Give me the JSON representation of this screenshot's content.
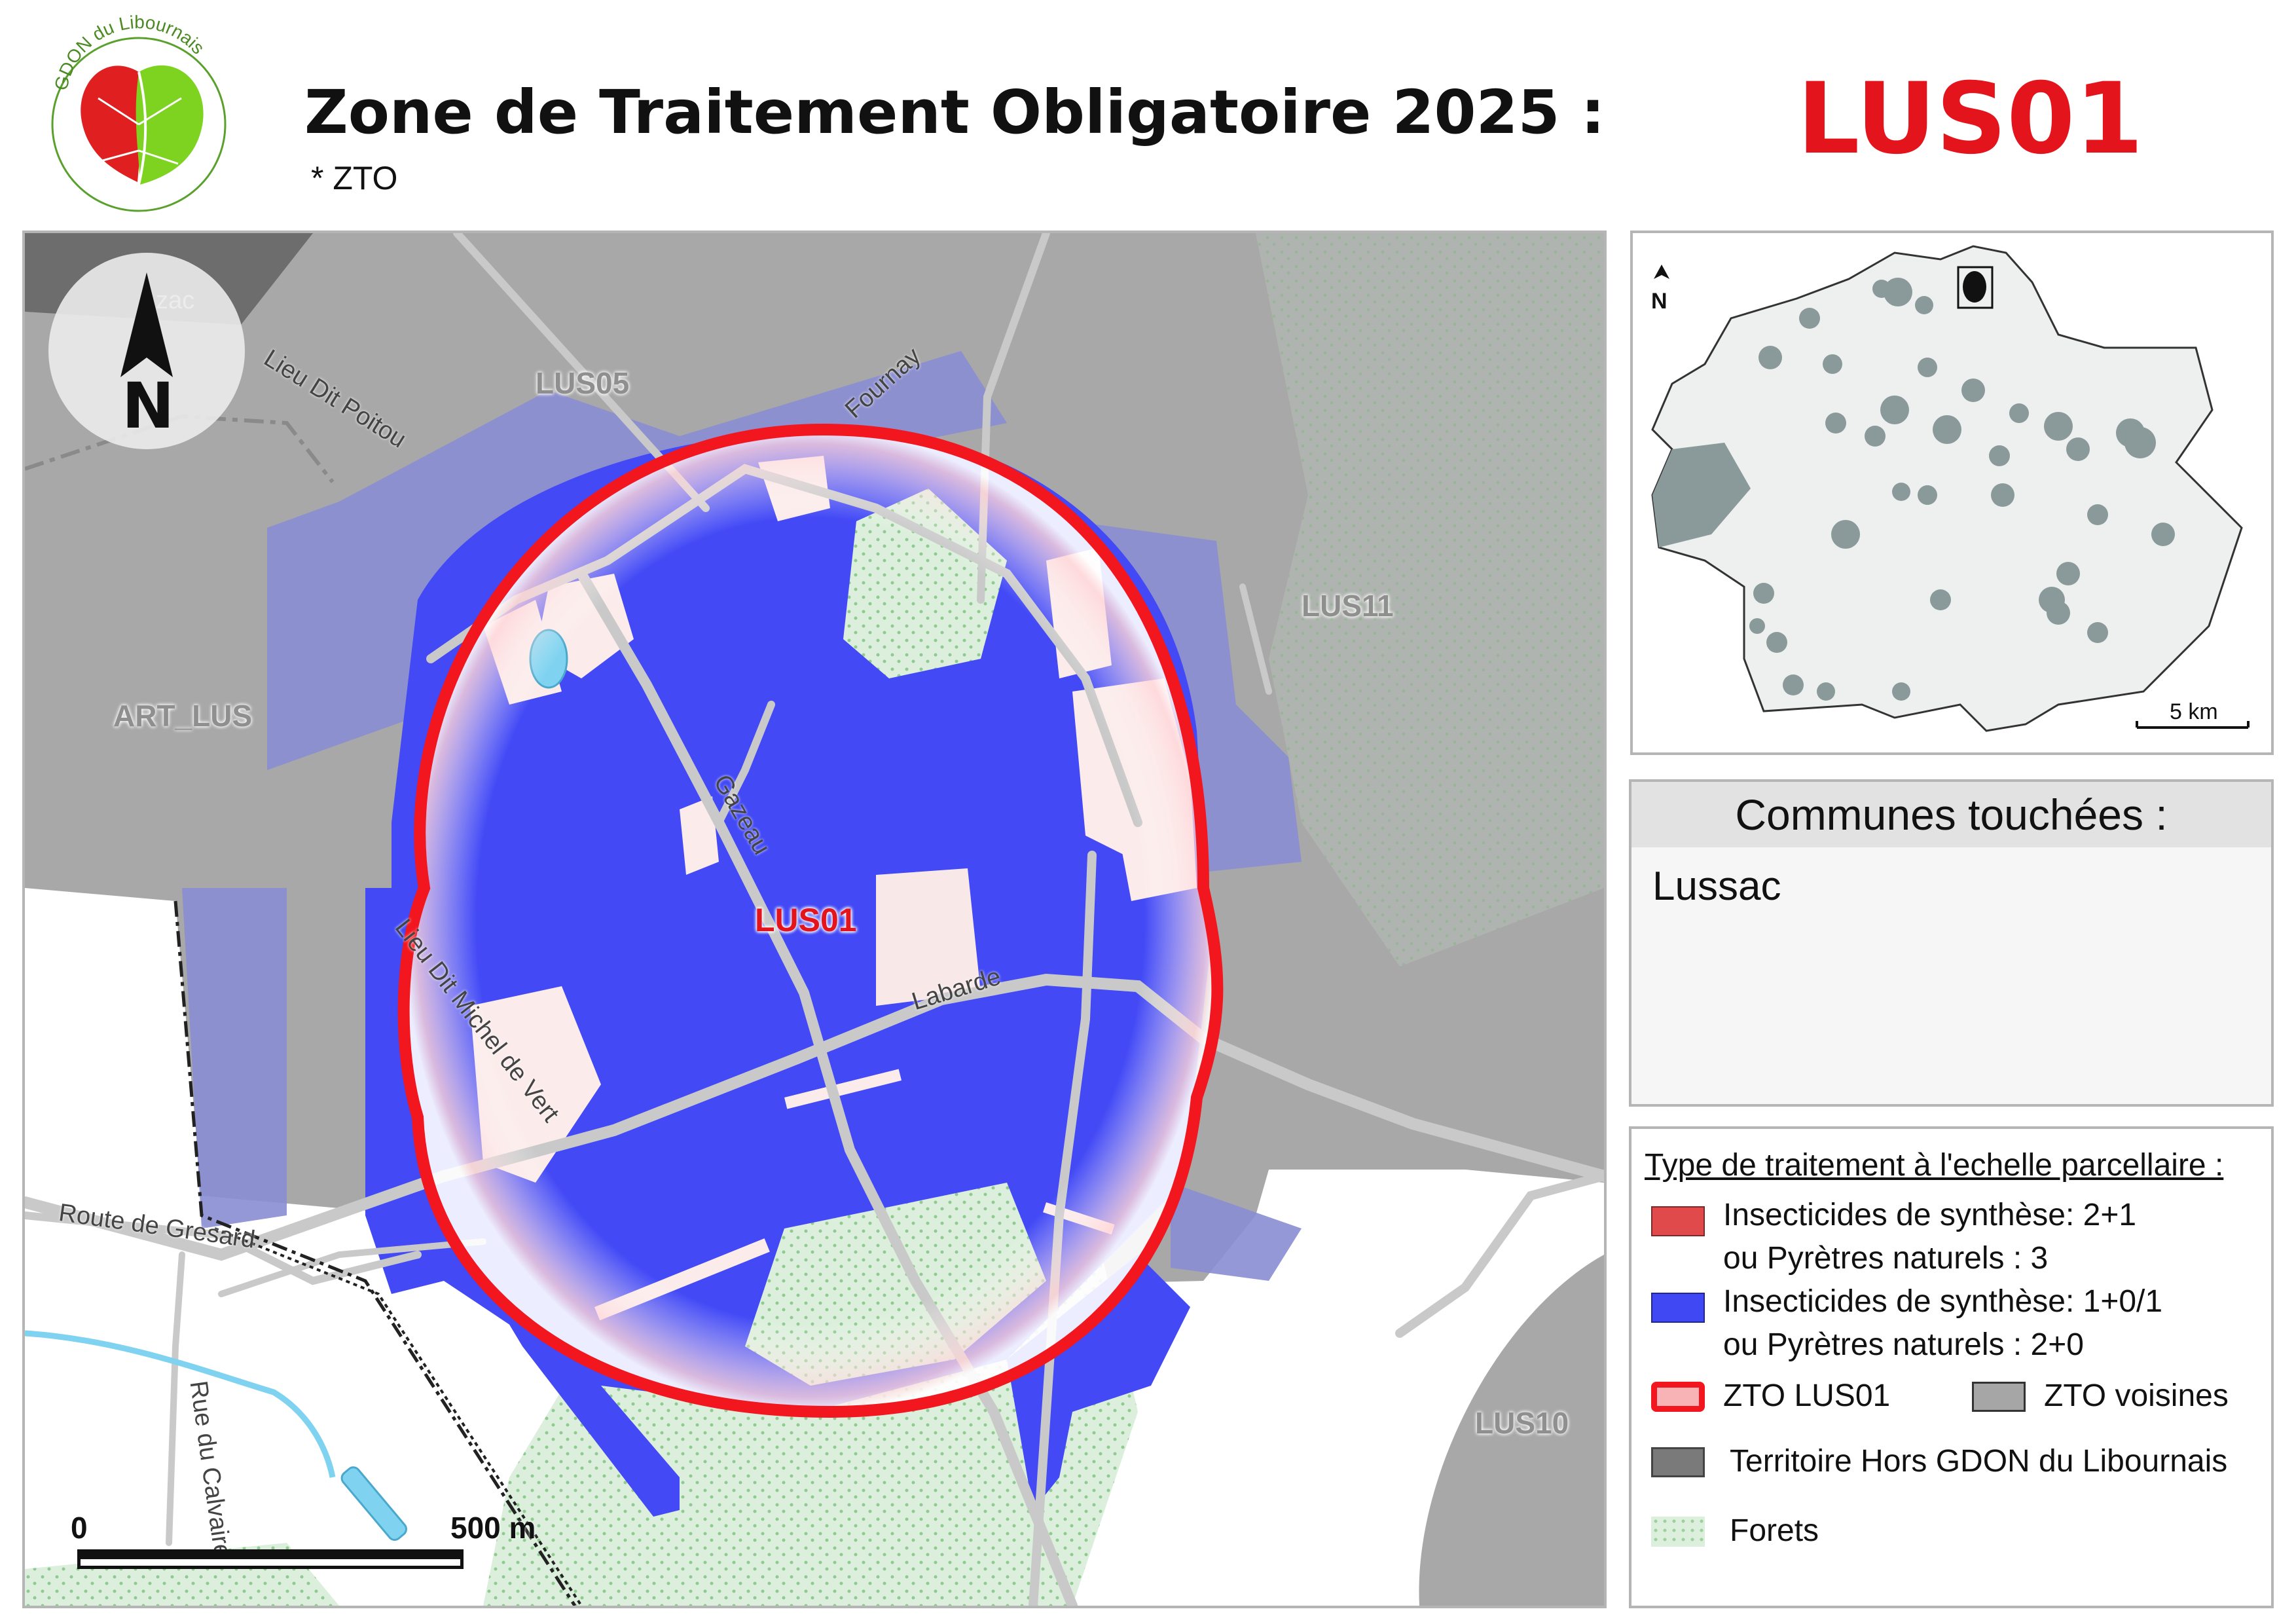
{
  "header": {
    "title": "Zone de Traitement Obligatoire 2025 :",
    "subtitle": "* ZTO",
    "zone_code": "LUS01"
  },
  "logo": {
    "text": "GDON du Libournais",
    "colors": [
      "#e02020",
      "#7ed321",
      "#5aa02c"
    ]
  },
  "main_map": {
    "zone_labels": {
      "center": "LUS01",
      "north": "LUS05",
      "east": "LUS11",
      "west": "ART_LUS",
      "southeast": "LUS10"
    },
    "road_labels": {
      "lieu_dit_poitou": "Lieu Dit Poitou",
      "fournay": "Fournay",
      "gazeau": "Gazeau",
      "labarde": "Labarde",
      "lieu_dit_michel": "Lieu Dit Michel de Vert",
      "route_gresard": "Route de Gresard",
      "rue_calvaire": "Rue du Calvaire",
      "lussac_partial": "zac"
    },
    "north_arrow": "N",
    "scale_bar": {
      "start": "0",
      "end": "500 m"
    },
    "colors": {
      "treatment_blue": "#4249f5",
      "zto_outline": "#f2161f",
      "neighbor_zto": "#a7a7a7",
      "outside_gdon": "#6d6d6d",
      "forest": "#d9efd9",
      "water": "#7fd3f0"
    }
  },
  "inset_map": {
    "north": "N",
    "scale": "5 km"
  },
  "communes": {
    "heading": "Communes touchées :",
    "items": [
      "Lussac"
    ]
  },
  "legend": {
    "title": "Type de traitement à l'echelle parcellaire :",
    "red_line1": "Insecticides de synthèse: 2+1",
    "red_line2": "ou Pyrètres naturels : 3",
    "blue_line1": "Insecticides de synthèse: 1+0/1",
    "blue_line2": "ou Pyrètres naturels : 2+0",
    "zto": "ZTO LUS01",
    "zto_neighbors": "ZTO voisines",
    "outside": "Territoire Hors GDON du Libournais",
    "forest": "Forets",
    "colors": {
      "red": "#e04a4a",
      "blue": "#3f48f2",
      "zto": "#f2161f",
      "neighbors": "#a6a6a6",
      "outside": "#7a7a7a",
      "forest": "#cfe8cf"
    }
  }
}
